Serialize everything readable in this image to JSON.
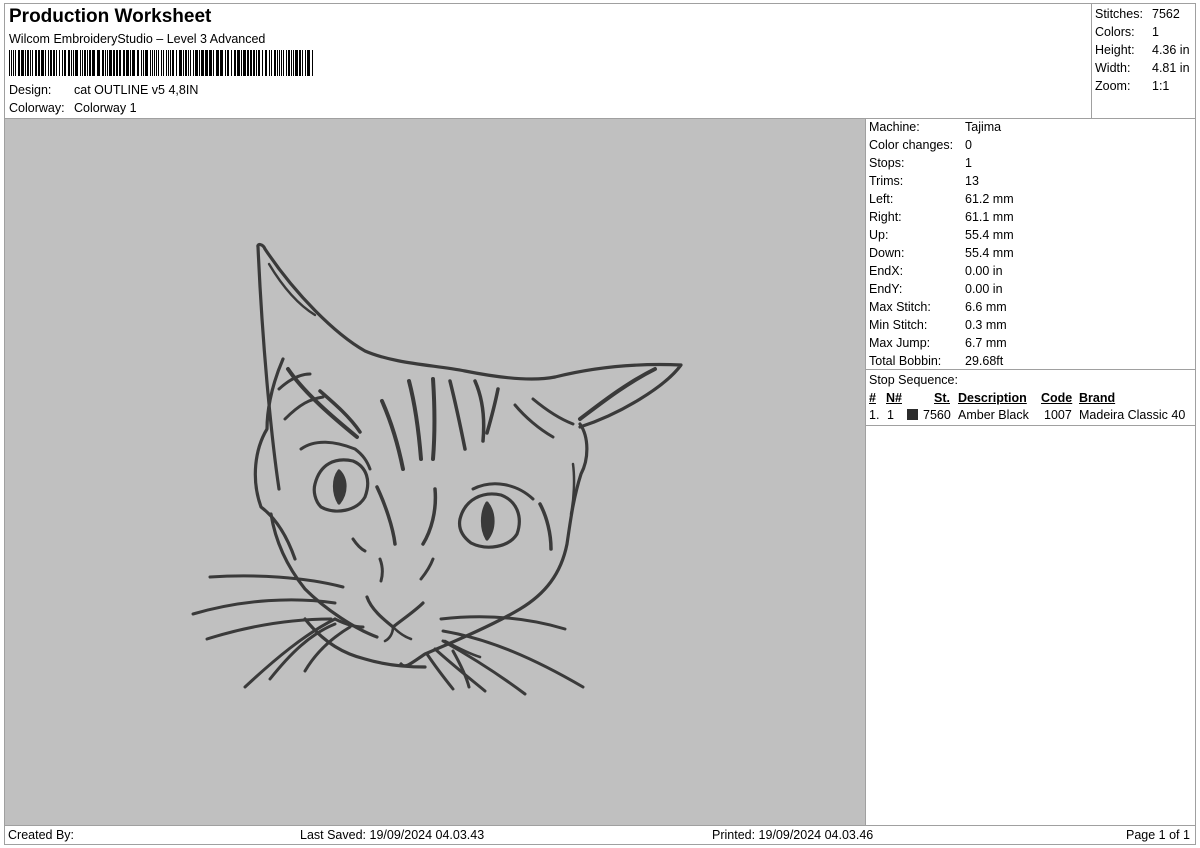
{
  "header": {
    "title": "Production Worksheet",
    "subtitle": "Wilcom EmbroideryStudio – Level 3 Advanced",
    "design_label": "Design:",
    "design_value": "cat OUTLINE v5 4,8IN",
    "colorway_label": "Colorway:",
    "colorway_value": "Colorway 1"
  },
  "stats": [
    {
      "label": "Stitches:",
      "value": "7562"
    },
    {
      "label": "Colors:",
      "value": "1"
    },
    {
      "label": "Height:",
      "value": "4.36 in"
    },
    {
      "label": "Width:",
      "value": "4.81 in"
    },
    {
      "label": "Zoom:",
      "value": "1:1"
    }
  ],
  "machine_info": [
    {
      "label": "Machine:",
      "value": "Tajima"
    },
    {
      "label": "Color changes:",
      "value": "0"
    },
    {
      "label": "Stops:",
      "value": "1"
    },
    {
      "label": "Trims:",
      "value": "13"
    },
    {
      "label": "Left:",
      "value": "61.2 mm"
    },
    {
      "label": "Right:",
      "value": "61.1 mm"
    },
    {
      "label": "Up:",
      "value": "55.4 mm"
    },
    {
      "label": "Down:",
      "value": "55.4 mm"
    },
    {
      "label": "EndX:",
      "value": "0.00 in"
    },
    {
      "label": "EndY:",
      "value": "0.00 in"
    },
    {
      "label": "Max Stitch:",
      "value": "6.6 mm"
    },
    {
      "label": "Min Stitch:",
      "value": "0.3 mm"
    },
    {
      "label": "Max Jump:",
      "value": "6.7 mm"
    },
    {
      "label": "Total Bobbin:",
      "value": "29.68ft"
    }
  ],
  "stop_sequence": {
    "title": "Stop Sequence:",
    "headers": {
      "num": "#",
      "n": "N#",
      "st": "St.",
      "description": "Description",
      "code": "Code",
      "brand": "Brand"
    },
    "rows": [
      {
        "num": "1.",
        "n": "1",
        "swatch_color": "#2b2b2b",
        "st": "7560",
        "description": "Amber Black",
        "code": "1007",
        "brand": "Madeira Classic 40"
      }
    ]
  },
  "footer": {
    "created_by": "Created By:",
    "last_saved": "Last Saved: 19/09/2024 04.03.43",
    "printed": "Printed: 19/09/2024 04.03.46",
    "page": "Page 1 of 1"
  },
  "colors": {
    "canvas_bg": "#c0c0c0",
    "thread": "#3a3a3a",
    "border": "#a0a0a0"
  }
}
